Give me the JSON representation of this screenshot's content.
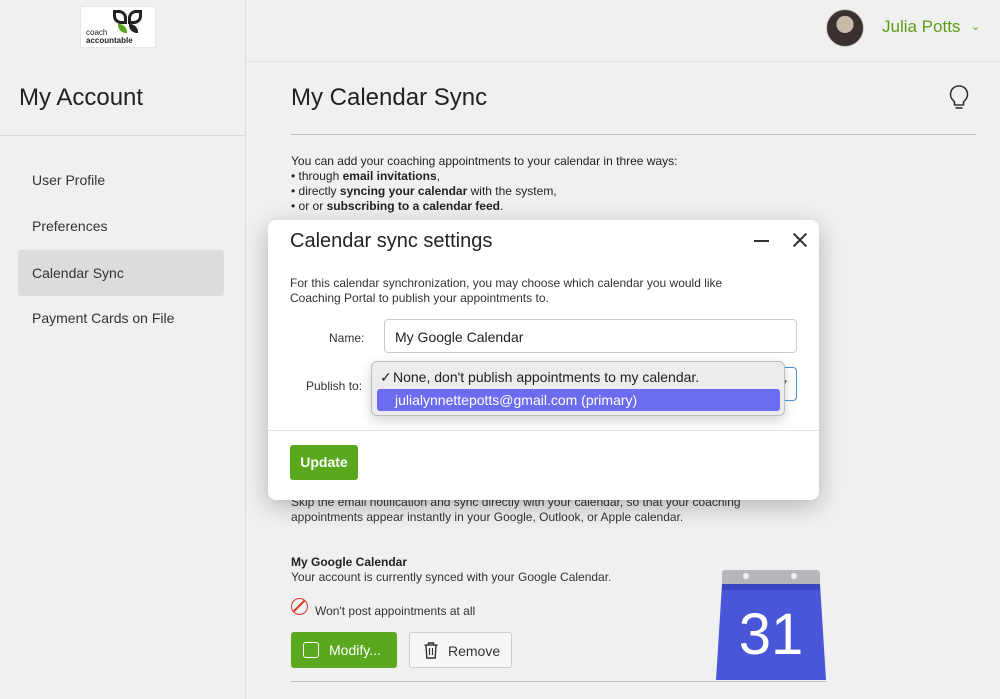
{
  "logo": {
    "line1": "coach",
    "line2": "accountable"
  },
  "user": {
    "name": "Julia Potts",
    "caret": "⌄"
  },
  "sidebar": {
    "title": "My Account",
    "items": [
      {
        "label": "User Profile",
        "active": false
      },
      {
        "label": "Preferences",
        "active": false
      },
      {
        "label": "Calendar Sync",
        "active": true
      },
      {
        "label": "Payment Cards on File",
        "active": false
      }
    ]
  },
  "main": {
    "title": "My Calendar Sync",
    "intro": "You can add your coaching appointments to your calendar in three ways:",
    "ways": [
      {
        "pre": "through ",
        "bold": "email invitations",
        "post": ","
      },
      {
        "pre": "directly ",
        "bold": "syncing your calendar",
        "post": " with the system,"
      },
      {
        "pre": "or or ",
        "bold": "subscribing to a calendar feed",
        "post": "."
      }
    ],
    "sync_desc": "Skip the email notification and sync directly with your calendar, so that your coaching appointments appear instantly in your Google, Outlook, or Apple calendar.",
    "calendar_name": "My Google Calendar",
    "calendar_status": "Your account is currently synced with your Google Calendar.",
    "post_status": "Won't post appointments at all",
    "modify_label": "Modify...",
    "remove_label": "Remove",
    "gcal_day": "31"
  },
  "modal": {
    "title": "Calendar sync settings",
    "description": "For this calendar synchronization, you may choose which calendar you would like Coaching Portal to publish your appointments to.",
    "name_label": "Name:",
    "name_value": "My Google Calendar",
    "publish_label": "Publish to:",
    "update_label": "Update",
    "options": [
      {
        "label": "None, don't publish appointments to my calendar.",
        "checked": true,
        "highlighted": false
      },
      {
        "label": "julialynnettepotts@gmail.com (primary)",
        "checked": false,
        "highlighted": true
      }
    ],
    "check_mark": "✓"
  },
  "colors": {
    "brand_green": "#5aa81d",
    "highlight": "#6b6cf0",
    "danger": "#d9372b",
    "gcal_blue": "#4a56d8"
  }
}
